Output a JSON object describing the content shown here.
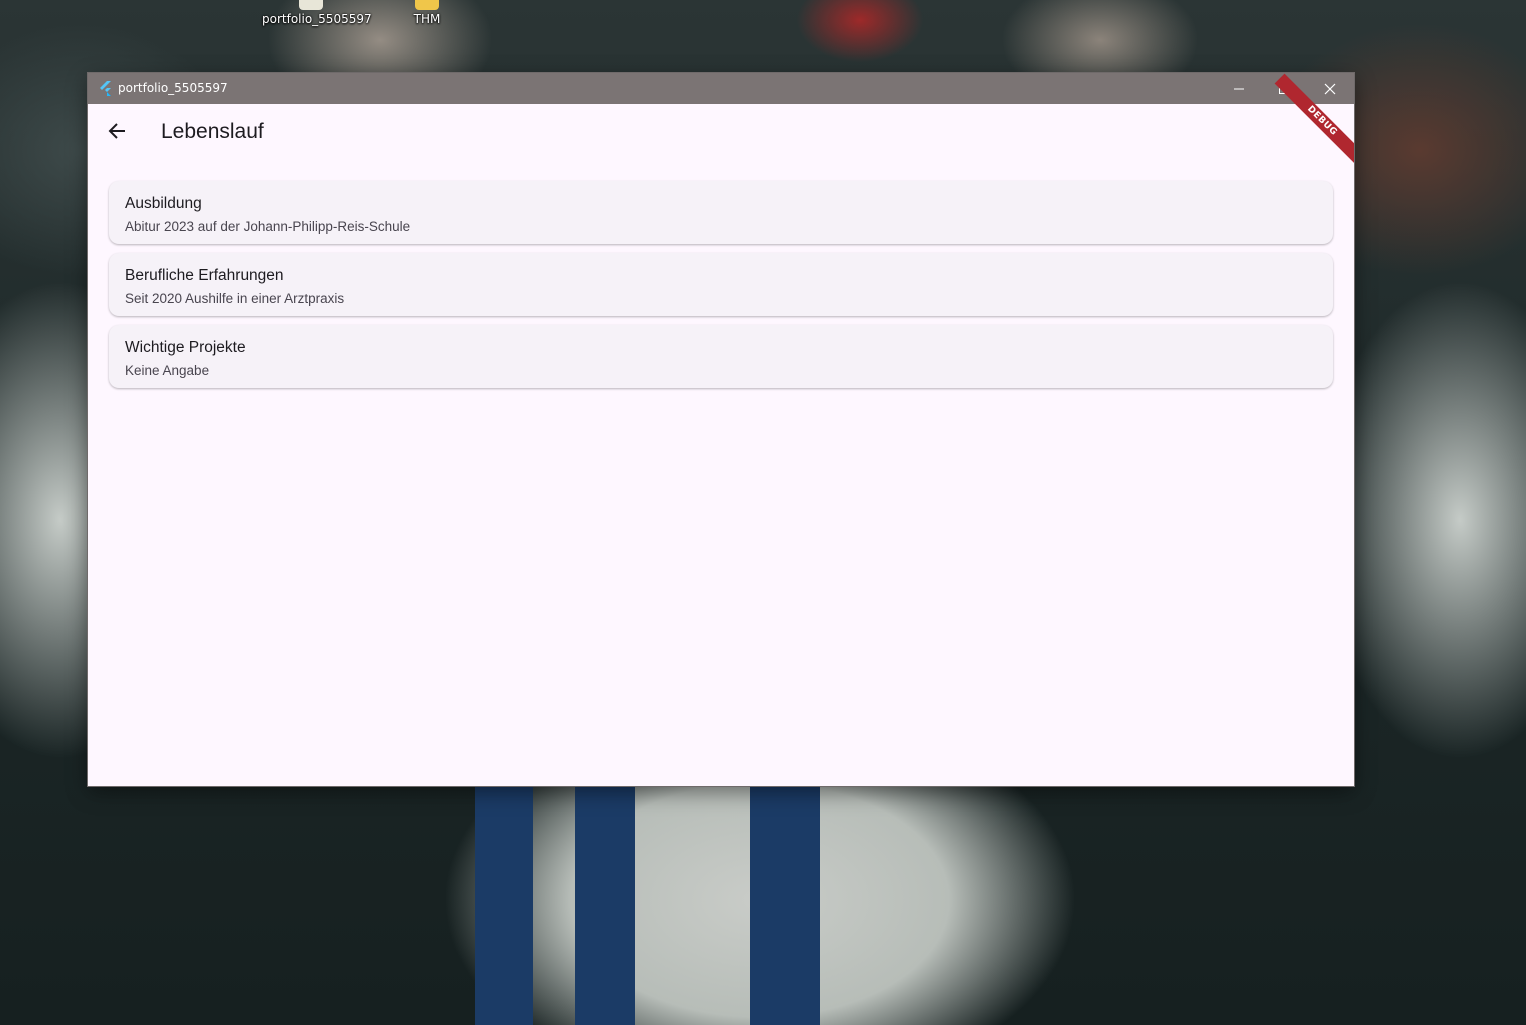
{
  "desktop": {
    "icons": [
      {
        "label": "portfolio_5505597",
        "icon": "app-shortcut-icon"
      },
      {
        "label": "THM",
        "icon": "folder-icon"
      }
    ]
  },
  "window": {
    "title": "portfolio_5505597",
    "logo_icon": "flutter-logo-icon",
    "controls": {
      "minimize_icon": "minimize-icon",
      "maximize_icon": "maximize-icon",
      "close_icon": "close-icon"
    }
  },
  "appbar": {
    "back_icon": "arrow-back-icon",
    "title": "Lebenslauf",
    "debug_banner": "DEBUG"
  },
  "sections": [
    {
      "title": "Ausbildung",
      "subtitle": "Abitur 2023 auf der Johann-Philipp-Reis-Schule"
    },
    {
      "title": "Berufliche Erfahrungen",
      "subtitle": "Seit 2020 Aushilfe in einer Arztpraxis"
    },
    {
      "title": "Wichtige Projekte",
      "subtitle": "Keine Angabe"
    }
  ],
  "colors": {
    "titlebar": "#7b7474",
    "app_background": "#fef7ff",
    "card_background": "#f6f2f8",
    "debug_banner": "#b0272f",
    "text_primary": "#1d1b20",
    "text_secondary": "#49454f"
  }
}
